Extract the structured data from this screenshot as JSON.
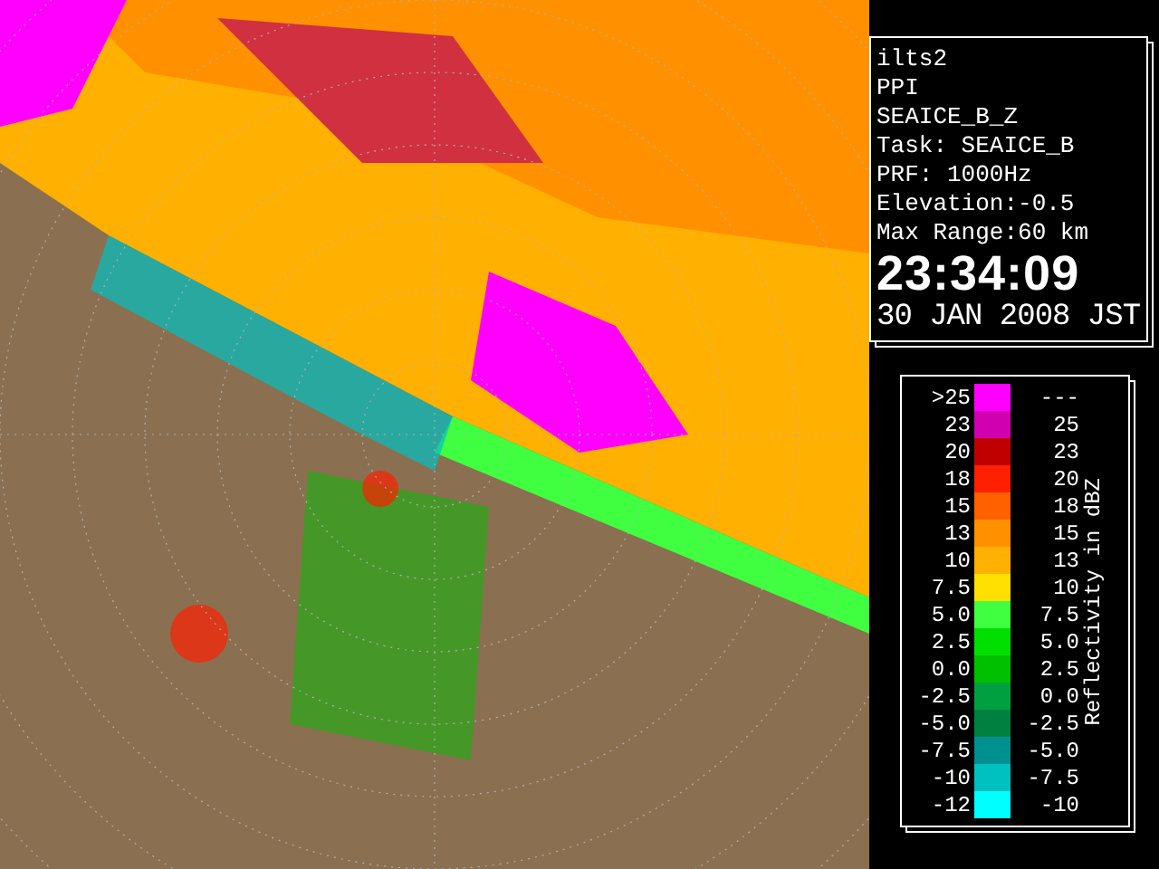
{
  "info": {
    "lines": [
      "ilts2",
      "PPI",
      "SEAICE_B_Z",
      "Task: SEAICE_B",
      "PRF: 1000Hz",
      "Elevation:-0.5",
      "Max Range:60 km"
    ],
    "time": "23:34:09",
    "date": "30 JAN 2008 JST"
  },
  "legend": {
    "title": "Reflectivity in dBZ",
    "rows": [
      {
        "low": ">25",
        "high": "---",
        "color": "#ff00ff"
      },
      {
        "low": "23",
        "high": "25",
        "color": "#d000b0"
      },
      {
        "low": "20",
        "high": "23",
        "color": "#c00000"
      },
      {
        "low": "18",
        "high": "20",
        "color": "#ff2000"
      },
      {
        "low": "15",
        "high": "18",
        "color": "#ff6000"
      },
      {
        "low": "13",
        "high": "15",
        "color": "#ff9000"
      },
      {
        "low": "10",
        "high": "13",
        "color": "#ffb000"
      },
      {
        "low": "7.5",
        "high": "10",
        "color": "#ffe000"
      },
      {
        "low": "5.0",
        "high": "7.5",
        "color": "#40ff40"
      },
      {
        "low": "2.5",
        "high": "5.0",
        "color": "#00e000"
      },
      {
        "low": "0.0",
        "high": "2.5",
        "color": "#00c000"
      },
      {
        "low": "-2.5",
        "high": "0.0",
        "color": "#00a040"
      },
      {
        "low": "-5.0",
        "high": "-2.5",
        "color": "#008040"
      },
      {
        "low": "-7.5",
        "high": "-5.0",
        "color": "#009090"
      },
      {
        "low": "-10",
        "high": "-7.5",
        "color": "#00c0c0"
      },
      {
        "low": "-12",
        "high": "-10",
        "color": "#00ffff"
      }
    ]
  }
}
